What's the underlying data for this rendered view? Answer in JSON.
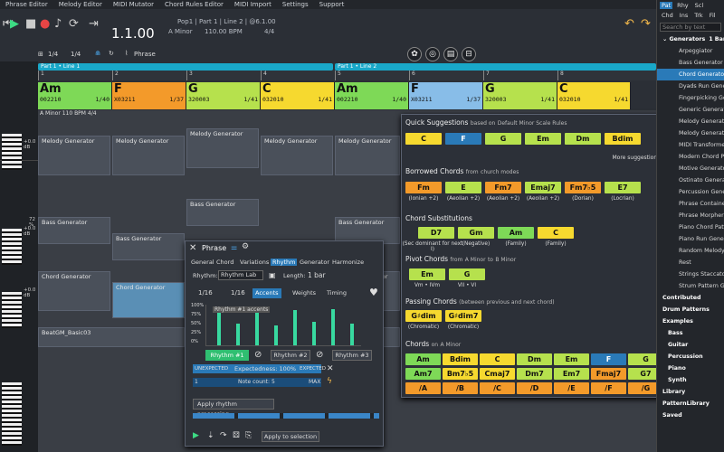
{
  "menu": [
    "Phrase Editor",
    "Melody Editor",
    "MIDI Mutator",
    "Chord Rules Editor",
    "MIDI Import",
    "Settings",
    "Support"
  ],
  "transport": {
    "position": "1.1.00",
    "key": "A Minor",
    "bpm": "110.00 BPM",
    "timesig": "4/4",
    "breadcrumb": "Pop1 | Part 1 | Line 2 | @6.1.00"
  },
  "toolbar": {
    "grid1": "1/4",
    "grid2": "1/4",
    "phrase_label": "Phrase"
  },
  "ruler": {
    "parts": [
      "Part 1 • Line 1",
      "Part 1 • Line 2"
    ],
    "ticks": [
      "1",
      "2",
      "3",
      "4",
      "5",
      "6",
      "7",
      "8"
    ]
  },
  "chords": [
    {
      "name": "Am",
      "tab": "002210",
      "pos": "1/40",
      "color": "#7ed957"
    },
    {
      "name": "F",
      "tab": "X03211",
      "pos": "1/37",
      "color": "#f39a2a"
    },
    {
      "name": "G",
      "tab": "320003",
      "pos": "1/41",
      "color": "#b6e14d"
    },
    {
      "name": "C",
      "tab": "032010",
      "pos": "1/41",
      "color": "#f6d92f"
    },
    {
      "name": "Am",
      "tab": "002210",
      "pos": "1/40",
      "color": "#7ed957"
    },
    {
      "name": "F",
      "tab": "X03211",
      "pos": "1/37",
      "color": "#88bde8"
    },
    {
      "name": "G",
      "tab": "320003",
      "pos": "1/41",
      "color": "#b6e14d"
    },
    {
      "name": "C",
      "tab": "032010",
      "pos": "1/41",
      "color": "#f6d92f"
    }
  ],
  "track_info": "A Minor  110 BPM  4/4",
  "clips": {
    "melody": "Melody Generator",
    "bass": "Bass Generator",
    "chord": "Chord Generator",
    "beat": "BeatGM_Basic03"
  },
  "track_levels": [
    "+0.0 dB",
    "72 %",
    "+0.0 dB",
    "+0.0 dB"
  ],
  "right_panel": {
    "tabs": [
      "Pat",
      "Rhy",
      "Scl",
      "Chd",
      "Ins",
      "Trk",
      "Fil"
    ],
    "search_placeholder": "Search by text",
    "section": "Generators",
    "section_count": "1 Bar",
    "items": [
      "Arpeggiator",
      "Bass Generator",
      "Chord Generator",
      "Dyads Run Generator",
      "Fingerpicking Generator",
      "Generic Generator",
      "Melody Generator",
      "Melody Generator",
      "MIDI Transformer",
      "Modern Chord Pat",
      "Motive Generator",
      "Ostinato Generator",
      "Percussion Generator",
      "Phrase Container",
      "Phrase Morpher",
      "Piano Chord Pattern",
      "Piano Run Generator",
      "Random Melody Gen",
      "Rest",
      "Strings Staccato G",
      "Strum Pattern Gen"
    ],
    "groups": [
      "Contributed",
      "Drum Patterns",
      "Examples",
      "Bass",
      "Guitar",
      "Percussion",
      "Piano",
      "Synth",
      "Library",
      "PatternLibrary",
      "Saved"
    ]
  },
  "suggestions": {
    "title": "Quick Suggestions",
    "based_on": "based on",
    "rules": "Default Minor Scale Rules",
    "quick": [
      "C",
      "F",
      "G",
      "Em",
      "Dm",
      "Bdim"
    ],
    "more": "More suggestions...",
    "borrowed_title": "Borrowed Chords",
    "borrowed_from": "from",
    "borrowed_src": "church modes",
    "borrowed": [
      {
        "c": "Fm",
        "s": "(Ionian +2)"
      },
      {
        "c": "E",
        "s": "(Aeolian +2)"
      },
      {
        "c": "Fm7",
        "s": "(Aeolian +2)"
      },
      {
        "c": "Emaj7",
        "s": "(Aeolian +2)"
      },
      {
        "c": "Fm7♭5",
        "s": "(Dorian)"
      },
      {
        "c": "E7",
        "s": "(Locrian)"
      }
    ],
    "subs_title": "Chord Substitutions",
    "subs": [
      {
        "c": "D7",
        "s": "(Sec dominant for next I)"
      },
      {
        "c": "Gm",
        "s": "(Negative)"
      },
      {
        "c": "Am",
        "s": "(Family)"
      },
      {
        "c": "C",
        "s": "(Family)"
      }
    ],
    "pivot_title": "Pivot Chords",
    "pivot_from": "from",
    "pivot_a": "A Minor",
    "pivot_to": "to",
    "pivot_b": "B Minor",
    "pivots": [
      {
        "c": "Em",
        "s": "Vm • IVm"
      },
      {
        "c": "G",
        "s": "VII • VI"
      }
    ],
    "passing_title": "Passing Chords",
    "passing_sub": "(between previous and next chord)",
    "passing": [
      {
        "c": "G♯dim",
        "s": "(Chromatic)"
      },
      {
        "c": "G♯dim7",
        "s": "(Chromatic)"
      }
    ],
    "chords_title": "Chords",
    "chords_on": "on",
    "chords_key": "A Minor",
    "row1": [
      "Am",
      "Bdim",
      "C",
      "Dm",
      "Em",
      "F",
      "G"
    ],
    "row2": [
      "Am7",
      "Bm7♭5",
      "Cmaj7",
      "Dm7",
      "Em7",
      "Fmaj7",
      "G7"
    ],
    "row3": [
      "/A",
      "/B",
      "/C",
      "/D",
      "/E",
      "/F",
      "/G"
    ]
  },
  "phrase": {
    "title": "Phrase",
    "tabs": [
      "General",
      "Chord",
      "Variations",
      "Rhythm",
      "Generator",
      "Harmonize"
    ],
    "rhythm_label": "Rhythm:",
    "rhythm_value": "Rhythm Lab",
    "length_label": "Length:",
    "length_value": "1 bar",
    "grid1": "1/16",
    "grid2": "1/16",
    "accents": "Accents",
    "weights": "Weights",
    "timing": "Timing",
    "accent_title": "Rhythm #1 accents",
    "pct": [
      "100%",
      "75%",
      "50%",
      "25%",
      "0%"
    ],
    "accents_values": [
      0.92,
      0.55,
      0.9,
      0.5,
      0.88,
      0.6,
      0.92,
      0.55
    ],
    "rhythms": [
      "Rhythm #1",
      "Rhythm #2",
      "Rhythm #3"
    ],
    "unexpected": "UNEXPECTED",
    "expectedness": "Expectedness: 100%",
    "expected": "EXPECTED",
    "note_min": "1",
    "note_count": "Note count: 5",
    "note_max": "MAX",
    "apply_processing": "Apply rhythm processing...",
    "apply_selection": "Apply to selection"
  }
}
